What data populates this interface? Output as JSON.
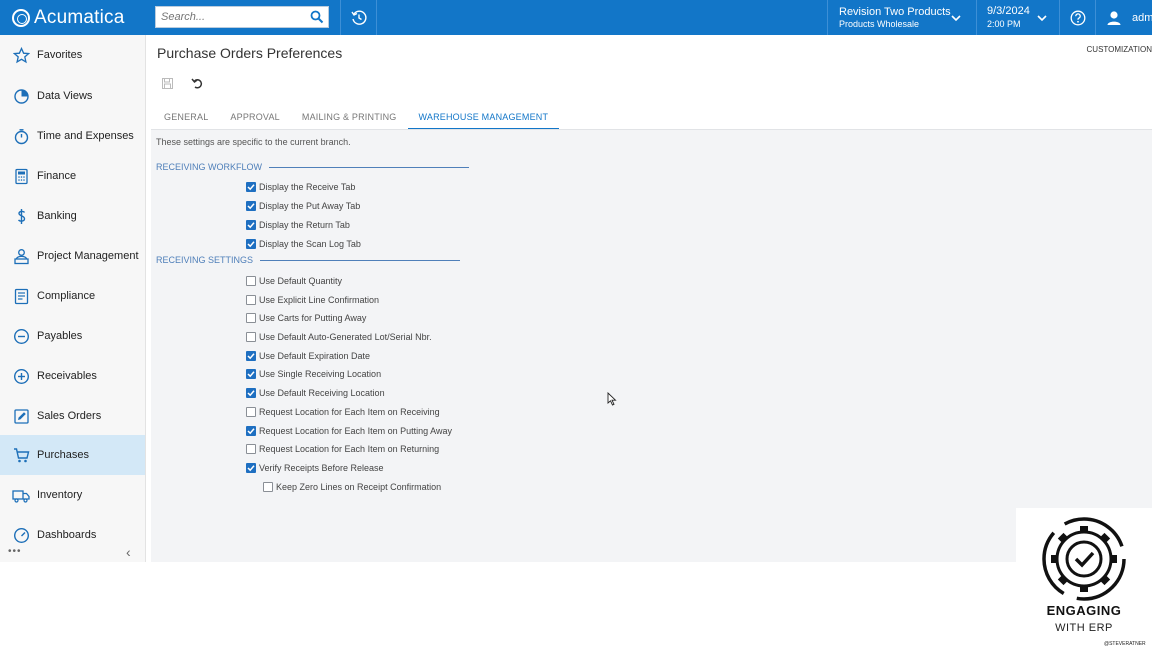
{
  "app": {
    "name": "Acumatica"
  },
  "search": {
    "placeholder": "Search..."
  },
  "company": {
    "name": "Revision Two Products",
    "branch": "Products Wholesale"
  },
  "datetime": {
    "date": "9/3/2024",
    "time": "2:00 PM"
  },
  "user": {
    "name": "admi"
  },
  "sidebar": {
    "items": [
      {
        "label": "Favorites",
        "icon": "star-icon"
      },
      {
        "label": "Data Views",
        "icon": "pie-chart-icon"
      },
      {
        "label": "Time and Expenses",
        "icon": "stopwatch-icon"
      },
      {
        "label": "Finance",
        "icon": "calculator-icon"
      },
      {
        "label": "Banking",
        "icon": "dollar-icon"
      },
      {
        "label": "Project Management",
        "icon": "team-icon"
      },
      {
        "label": "Compliance",
        "icon": "checklist-icon"
      },
      {
        "label": "Payables",
        "icon": "minus-circle-icon"
      },
      {
        "label": "Receivables",
        "icon": "plus-circle-icon"
      },
      {
        "label": "Sales Orders",
        "icon": "pencil-icon"
      },
      {
        "label": "Purchases",
        "icon": "cart-icon",
        "active": true
      },
      {
        "label": "Inventory",
        "icon": "truck-icon"
      },
      {
        "label": "Dashboards",
        "icon": "gauge-icon"
      }
    ],
    "more": "•••",
    "collapse": "‹"
  },
  "page": {
    "title": "Purchase Orders Preferences",
    "customization": "CUSTOMIZATION"
  },
  "tabs": [
    {
      "label": "GENERAL"
    },
    {
      "label": "APPROVAL"
    },
    {
      "label": "MAILING & PRINTING"
    },
    {
      "label": "WAREHOUSE MANAGEMENT",
      "active": true
    }
  ],
  "panel": {
    "note": "These settings are specific to the current branch.",
    "receiving_workflow": {
      "title": "RECEIVING WORKFLOW",
      "options": [
        {
          "label": "Display the Receive Tab",
          "checked": true
        },
        {
          "label": "Display the Put Away Tab",
          "checked": true
        },
        {
          "label": "Display the Return Tab",
          "checked": true
        },
        {
          "label": "Display the Scan Log Tab",
          "checked": true
        }
      ]
    },
    "receiving_settings": {
      "title": "RECEIVING SETTINGS",
      "options": [
        {
          "label": "Use Default Quantity",
          "checked": false
        },
        {
          "label": "Use Explicit Line Confirmation",
          "checked": false
        },
        {
          "label": "Use Carts for Putting Away",
          "checked": false
        },
        {
          "label": "Use Default Auto-Generated Lot/Serial Nbr.",
          "checked": false
        },
        {
          "label": "Use Default Expiration Date",
          "checked": true
        },
        {
          "label": "Use Single Receiving Location",
          "checked": true
        },
        {
          "label": "Use Default Receiving Location",
          "checked": true
        },
        {
          "label": "Request Location for Each Item on Receiving",
          "checked": false
        },
        {
          "label": "Request Location for Each Item on Putting Away",
          "checked": true
        },
        {
          "label": "Request Location for Each Item on Returning",
          "checked": false
        },
        {
          "label": "Verify Receipts Before Release",
          "checked": true
        },
        {
          "label": "Keep Zero Lines on Receipt Confirmation",
          "checked": false
        }
      ]
    }
  },
  "watermark": {
    "line1": "ENGAGING",
    "line2": "WITH ERP",
    "handle": "@STEVERATNER"
  },
  "colors": {
    "brand_blue": "#1276c8",
    "section_blue": "#4f7fb9",
    "active_nav_bg": "#d3e8f7",
    "panel_bg": "#f3f4f6"
  }
}
